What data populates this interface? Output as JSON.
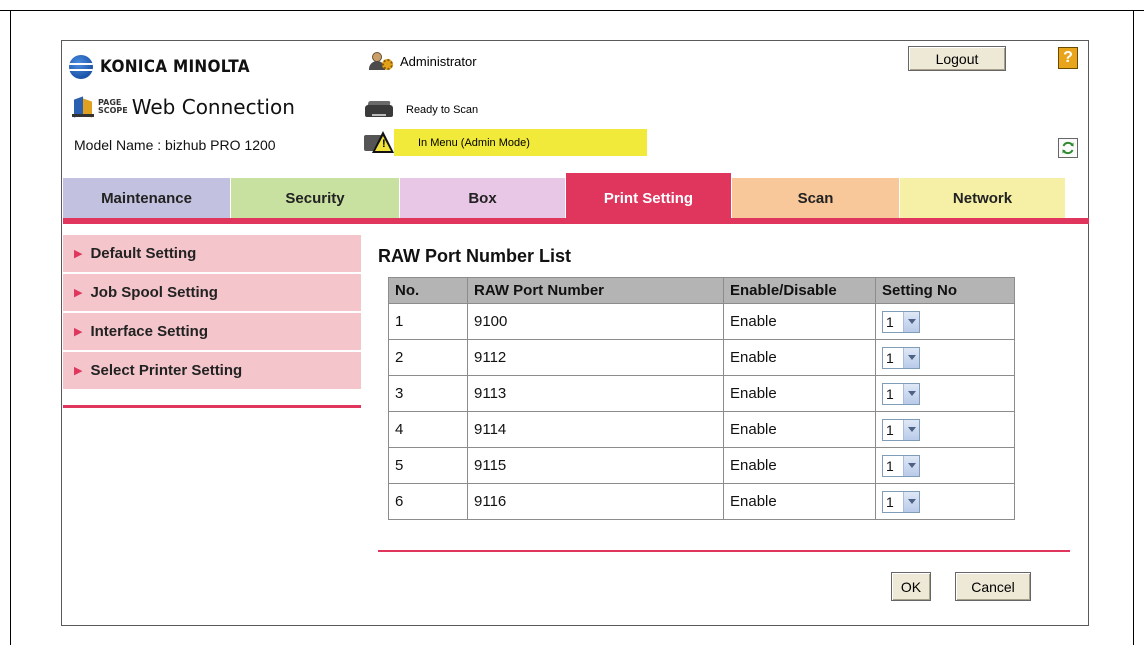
{
  "header": {
    "brand": "KONICA MINOLTA",
    "pagescope_small_top": "PAGE",
    "pagescope_small_bottom": "SCOPE",
    "product_title": "Web Connection",
    "model_label": "Model Name : bizhub PRO 1200",
    "user_role": "Administrator",
    "status_ready": "Ready to Scan",
    "status_mode": "In Menu (Admin Mode)",
    "logout_label": "Logout",
    "help_label": "?"
  },
  "tabs": [
    {
      "label": "Maintenance",
      "color": "#c2c2e0",
      "active": false
    },
    {
      "label": "Security",
      "color": "#c8e0a0",
      "active": false
    },
    {
      "label": "Box",
      "color": "#e8c6e6",
      "active": false
    },
    {
      "label": "Print Setting",
      "color": "#e0365e",
      "active": true
    },
    {
      "label": "Scan",
      "color": "#f8c79a",
      "active": false
    },
    {
      "label": "Network",
      "color": "#f5f0a6",
      "active": false
    }
  ],
  "sidebar": {
    "items": [
      {
        "label": "Default Setting",
        "active": false
      },
      {
        "label": "Job Spool Setting",
        "active": false
      },
      {
        "label": "Interface Setting",
        "active": false
      },
      {
        "label": "Select Printer Setting",
        "active": true
      }
    ]
  },
  "main": {
    "title": "RAW Port Number List",
    "columns": [
      "No.",
      "RAW Port Number",
      "Enable/Disable",
      "Setting No"
    ],
    "rows": [
      {
        "no": "1",
        "port": "9100",
        "state": "Enable",
        "setting": "1"
      },
      {
        "no": "2",
        "port": "9112",
        "state": "Enable",
        "setting": "1"
      },
      {
        "no": "3",
        "port": "9113",
        "state": "Enable",
        "setting": "1"
      },
      {
        "no": "4",
        "port": "9114",
        "state": "Enable",
        "setting": "1"
      },
      {
        "no": "5",
        "port": "9115",
        "state": "Enable",
        "setting": "1"
      },
      {
        "no": "6",
        "port": "9116",
        "state": "Enable",
        "setting": "1"
      }
    ],
    "ok_label": "OK",
    "cancel_label": "Cancel"
  },
  "colors": {
    "accent": "#e0365e",
    "sidebar_bg": "#f4c6cc",
    "status_highlight": "#f2ea3a",
    "table_header": "#b4b4b4"
  }
}
